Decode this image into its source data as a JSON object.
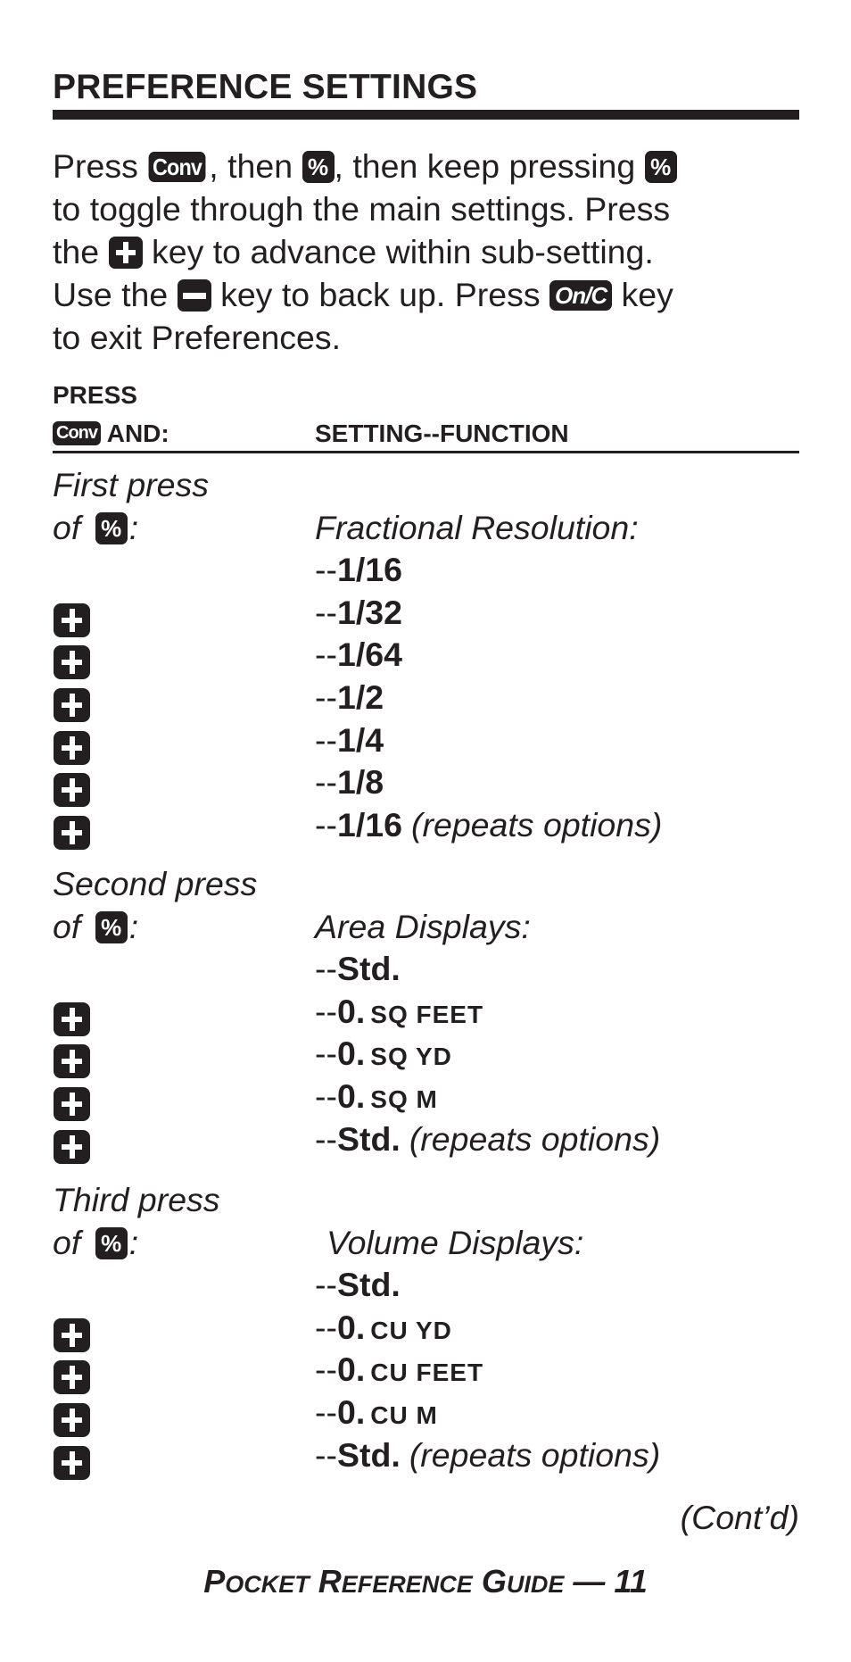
{
  "title": "PREFERENCE SETTINGS",
  "intro": {
    "line1": {
      "a": "Press ",
      "key1": "Conv",
      "b": ", then ",
      "key2": "%",
      "c": ", then keep pressing ",
      "key3": "%"
    },
    "line2": "to toggle through the main settings. Press",
    "line3": {
      "a": "the ",
      "key": "plus-key",
      "b": " key to advance within sub-setting."
    },
    "line4": {
      "a": "Use the ",
      "key": "minus-key",
      "b": " key to back up. Press ",
      "key2": "On/C",
      "c": " key"
    },
    "line5": "to exit Preferences."
  },
  "table_header": {
    "press": "PRESS",
    "conv_key": "Conv",
    "and": " AND:",
    "setting_function": "SETTING--FUNCTION"
  },
  "sections": [
    {
      "press_line1": "First press",
      "press_line2": "of ",
      "key": "%",
      "colon": ":",
      "setting_name": "Fractional Resolution:",
      "options": [
        {
          "prefix": "--",
          "value": "1/16",
          "unit": "",
          "note": "",
          "key": ""
        },
        {
          "prefix": "--",
          "value": "1/32",
          "unit": "",
          "note": "",
          "key": "plus"
        },
        {
          "prefix": "--",
          "value": "1/64",
          "unit": "",
          "note": "",
          "key": "plus"
        },
        {
          "prefix": "--",
          "value": "1/2",
          "unit": "",
          "note": "",
          "key": "plus"
        },
        {
          "prefix": "--",
          "value": "1/4",
          "unit": "",
          "note": "",
          "key": "plus"
        },
        {
          "prefix": "--",
          "value": "1/8",
          "unit": "",
          "note": "",
          "key": "plus"
        },
        {
          "prefix": "--",
          "value": "1/16",
          "unit": "",
          "note": "(repeats options)",
          "key": "plus"
        }
      ]
    },
    {
      "press_line1": "Second press",
      "press_line2": "of ",
      "key": "%",
      "colon": ":",
      "setting_name": "Area Displays:",
      "options": [
        {
          "prefix": "--",
          "value": "Std.",
          "unit": "",
          "note": "",
          "key": ""
        },
        {
          "prefix": "--",
          "value": "0.",
          "unit": "SQ FEET",
          "note": "",
          "key": "plus"
        },
        {
          "prefix": "--",
          "value": "0.",
          "unit": "SQ YD",
          "note": "",
          "key": "plus"
        },
        {
          "prefix": "--",
          "value": "0.",
          "unit": "SQ M",
          "note": "",
          "key": "plus"
        },
        {
          "prefix": "--",
          "value": "Std.",
          "unit": "",
          "note": "(repeats options)",
          "key": "plus"
        }
      ]
    },
    {
      "press_line1": "Third press",
      "press_line2": "of ",
      "key": "%",
      "colon": ":",
      "setting_name": "Volume Displays:",
      "options": [
        {
          "prefix": "--",
          "value": "Std.",
          "unit": "",
          "note": "",
          "key": ""
        },
        {
          "prefix": "--",
          "value": "0.",
          "unit": "CU YD",
          "note": "",
          "key": "plus"
        },
        {
          "prefix": "--",
          "value": "0.",
          "unit": "CU FEET",
          "note": "",
          "key": "plus"
        },
        {
          "prefix": "--",
          "value": "0.",
          "unit": "CU M",
          "note": "",
          "key": "plus"
        },
        {
          "prefix": "--",
          "value": "Std.",
          "unit": "",
          "note": "(repeats options)",
          "key": "plus"
        }
      ]
    }
  ],
  "continued": "(Cont’d)",
  "footer": {
    "p": "P",
    "ocket": "OCKET",
    "r": " R",
    "eference": "EFERENCE",
    "g": " G",
    "uide": "UIDE",
    "page": " — 11"
  }
}
